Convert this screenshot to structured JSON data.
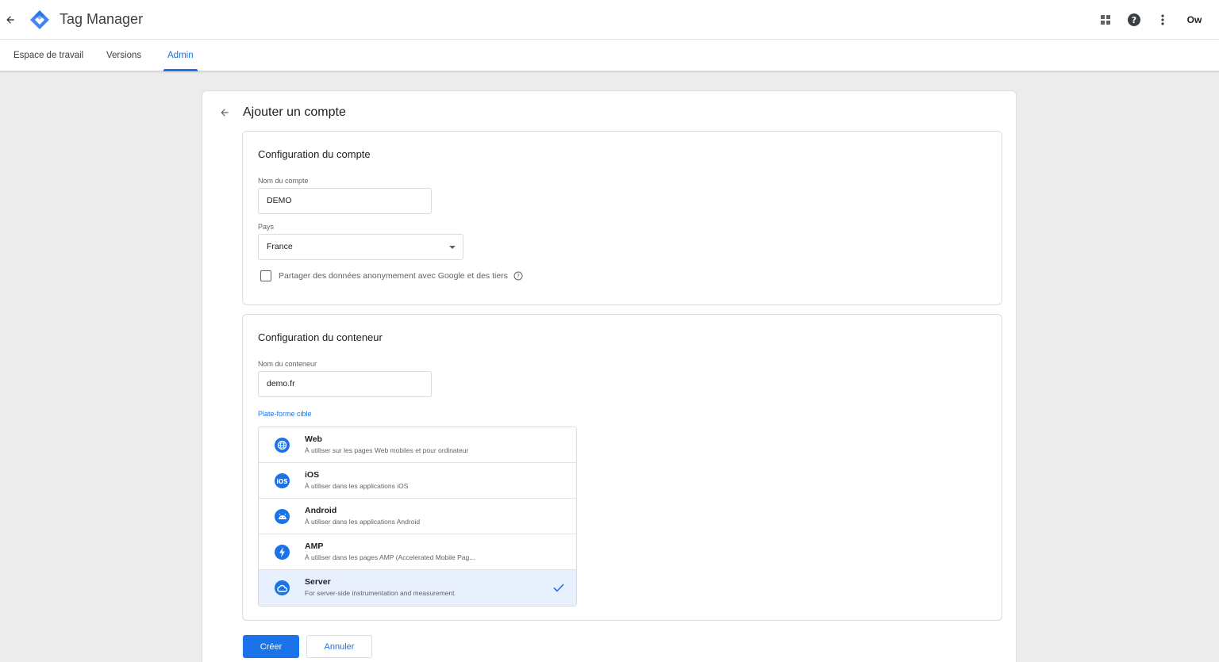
{
  "header": {
    "back_icon": "arrow-back-icon",
    "logo_icon": "tag-manager-logo",
    "app_title": "Tag Manager",
    "apps_icon": "apps-grid-icon",
    "help_icon": "help-icon",
    "more_icon": "more-vert-icon",
    "account_label": "Ow"
  },
  "tabs": [
    {
      "label": "Espace de travail",
      "active": false
    },
    {
      "label": "Versions",
      "active": false
    },
    {
      "label": "Admin",
      "active": true
    }
  ],
  "page": {
    "title": "Ajouter un compte"
  },
  "account_section": {
    "title": "Configuration du compte",
    "name_label": "Nom du compte",
    "name_value": "DEMO",
    "country_label": "Pays",
    "country_value": "France",
    "share_checkbox_label": "Partager des données anonymement avec Google et des tiers",
    "share_checked": false
  },
  "container_section": {
    "title": "Configuration du conteneur",
    "name_label": "Nom du conteneur",
    "name_value": "demo.fr",
    "platform_label": "Plate-forme cible",
    "platforms": [
      {
        "name": "Web",
        "desc": "À utiliser sur les pages Web mobiles et pour ordinateur",
        "icon": "globe-icon",
        "selected": false
      },
      {
        "name": "iOS",
        "desc": "À utiliser dans les applications iOS",
        "icon": "ios-icon",
        "selected": false
      },
      {
        "name": "Android",
        "desc": "À utiliser dans les applications Android",
        "icon": "android-icon",
        "selected": false
      },
      {
        "name": "AMP",
        "desc": "À utiliser dans les pages AMP (Accelerated Mobile Pag...",
        "icon": "lightning-icon",
        "selected": false
      },
      {
        "name": "Server",
        "desc": "For server-side instrumentation and measurement",
        "icon": "cloud-icon",
        "selected": true
      }
    ]
  },
  "actions": {
    "create_label": "Créer",
    "cancel_label": "Annuler"
  },
  "colors": {
    "accent": "#1a73e8",
    "selected_bg": "#e8f0fe",
    "page_bg": "#ececec"
  }
}
